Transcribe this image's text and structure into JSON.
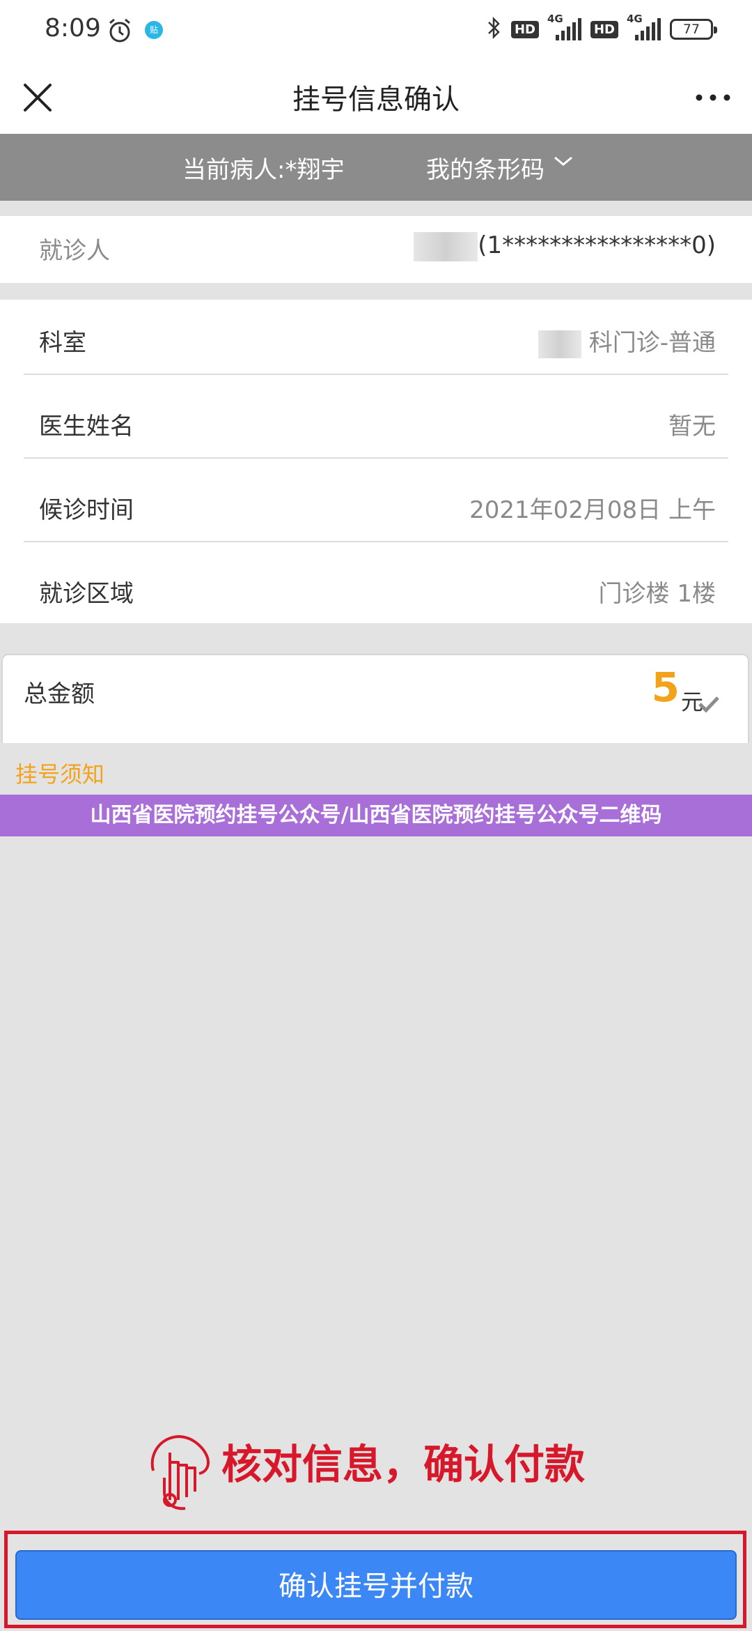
{
  "status_bar": {
    "time": "8:09",
    "network_hd_1": "HD",
    "network_4g_1": "4G",
    "network_hd_2": "HD",
    "network_4g_2": "4G",
    "battery": "77"
  },
  "header": {
    "title": "挂号信息确认"
  },
  "patient_bar": {
    "current_patient": "当前病人:*翔宇",
    "barcode_label": "我的条形码"
  },
  "visitor": {
    "label": "就诊人",
    "value": "(1****************0)"
  },
  "details": {
    "department_label": "科室",
    "department_value": "科门诊-普通",
    "doctor_label": "医生姓名",
    "doctor_value": "暂无",
    "time_label": "候诊时间",
    "time_value": "2021年02月08日 上午",
    "area_label": "就诊区域",
    "area_value": "门诊楼 1楼"
  },
  "amount": {
    "label": "总金额",
    "value": "5",
    "unit": "元"
  },
  "notice_link": "挂号须知",
  "watermark_text": "山西省医院预约挂号公众号/山西省医院预约挂号公众号二维码",
  "instruction_text": "核对信息，确认付款",
  "confirm_button": "确认挂号并付款",
  "colors": {
    "accent_orange": "#f3a31b",
    "button_blue": "#3a87f5",
    "instruction_red": "#d7182a",
    "watermark_purple": "#a86fd8",
    "patient_bar_gray": "#8c8c8c"
  }
}
